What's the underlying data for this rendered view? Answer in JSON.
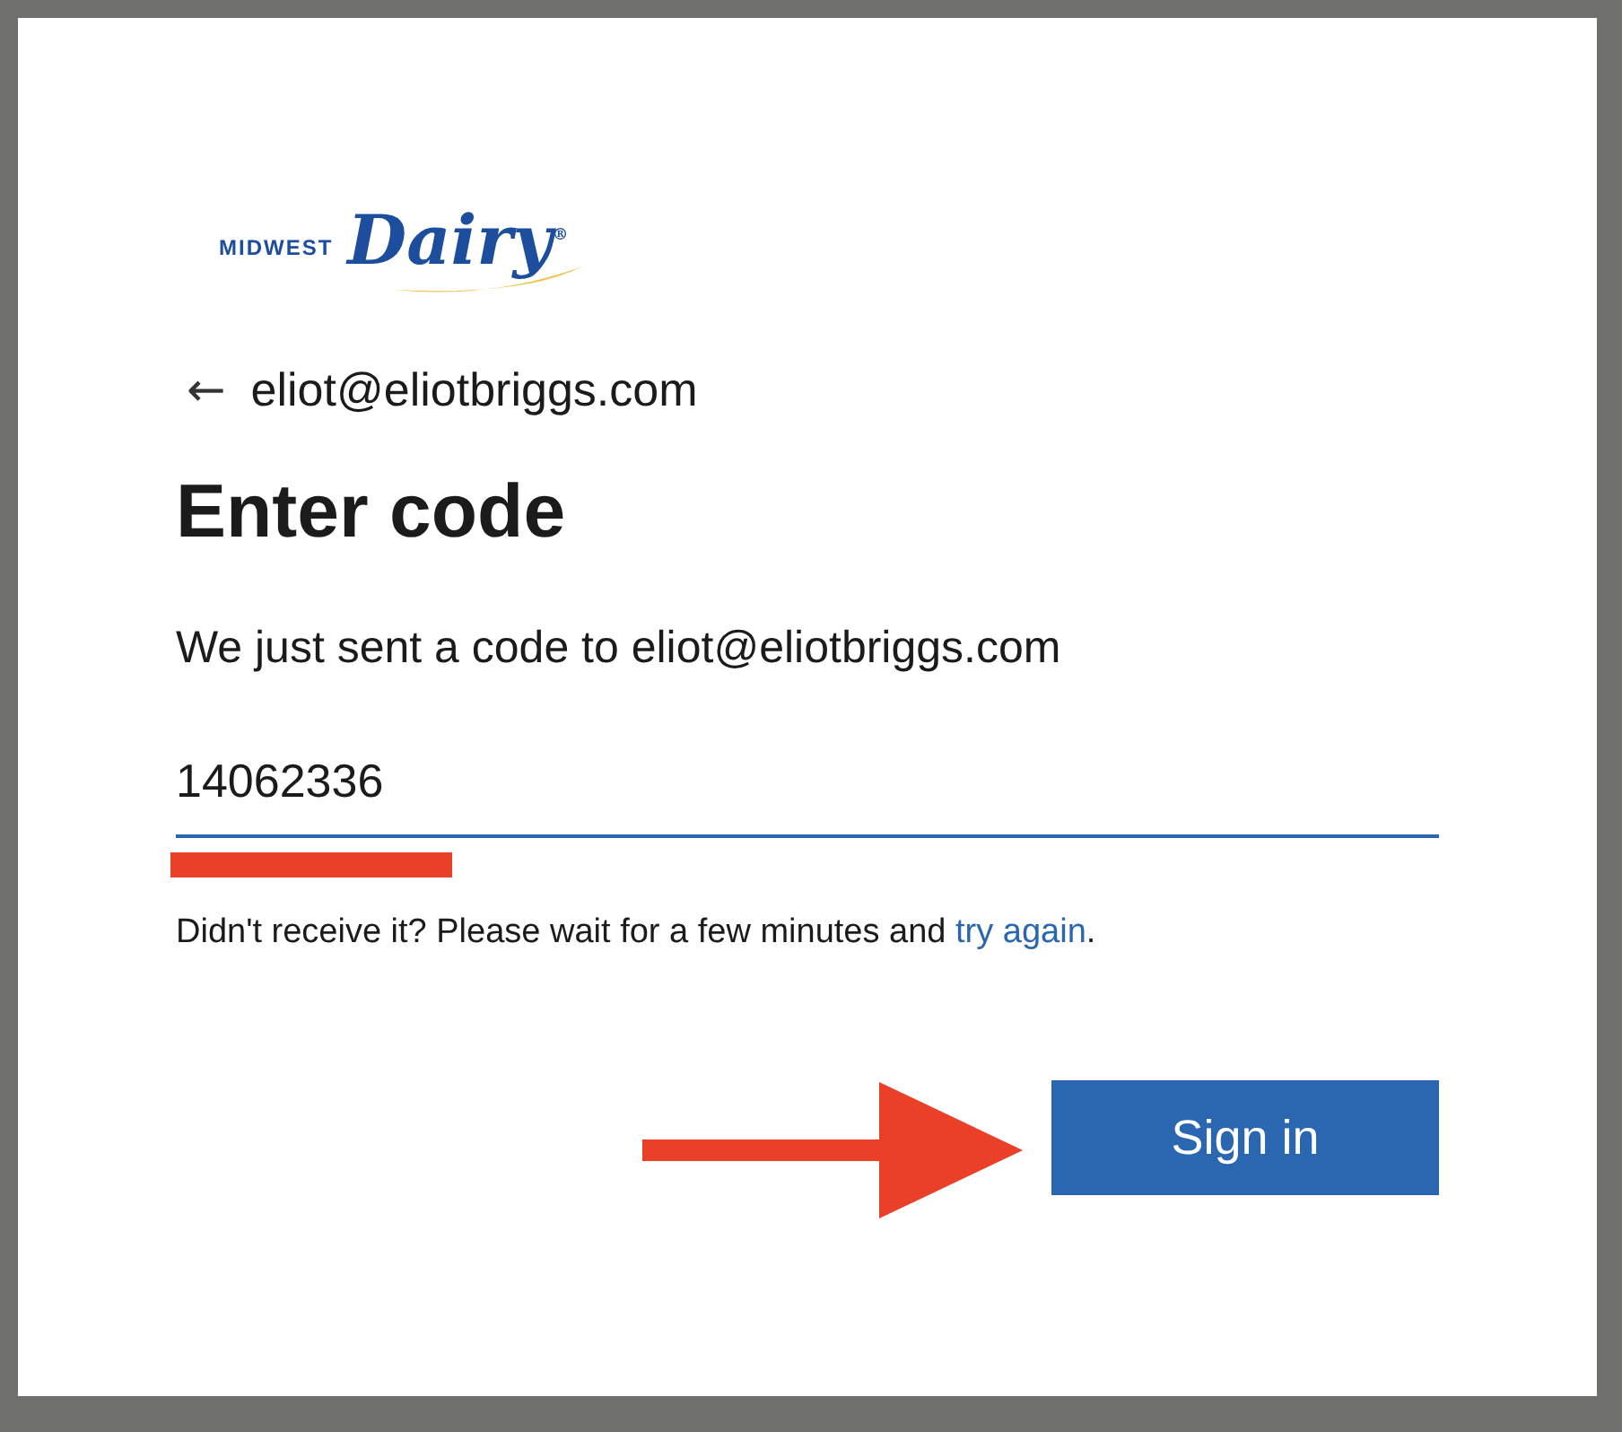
{
  "logo": {
    "small_text": "MIDWEST",
    "script_text": "Dairy",
    "mark": "®"
  },
  "back": {
    "arrow": "←",
    "email": "eliot@eliotbriggs.com"
  },
  "heading": "Enter code",
  "message": "We just sent a code to eliot@eliotbriggs.com",
  "code_field": {
    "value": "14062336"
  },
  "hint": {
    "text": "Didn't receive it? Please wait for a few minutes and ",
    "link": "try again",
    "end": "."
  },
  "buttons": [
    "Sign in"
  ]
}
